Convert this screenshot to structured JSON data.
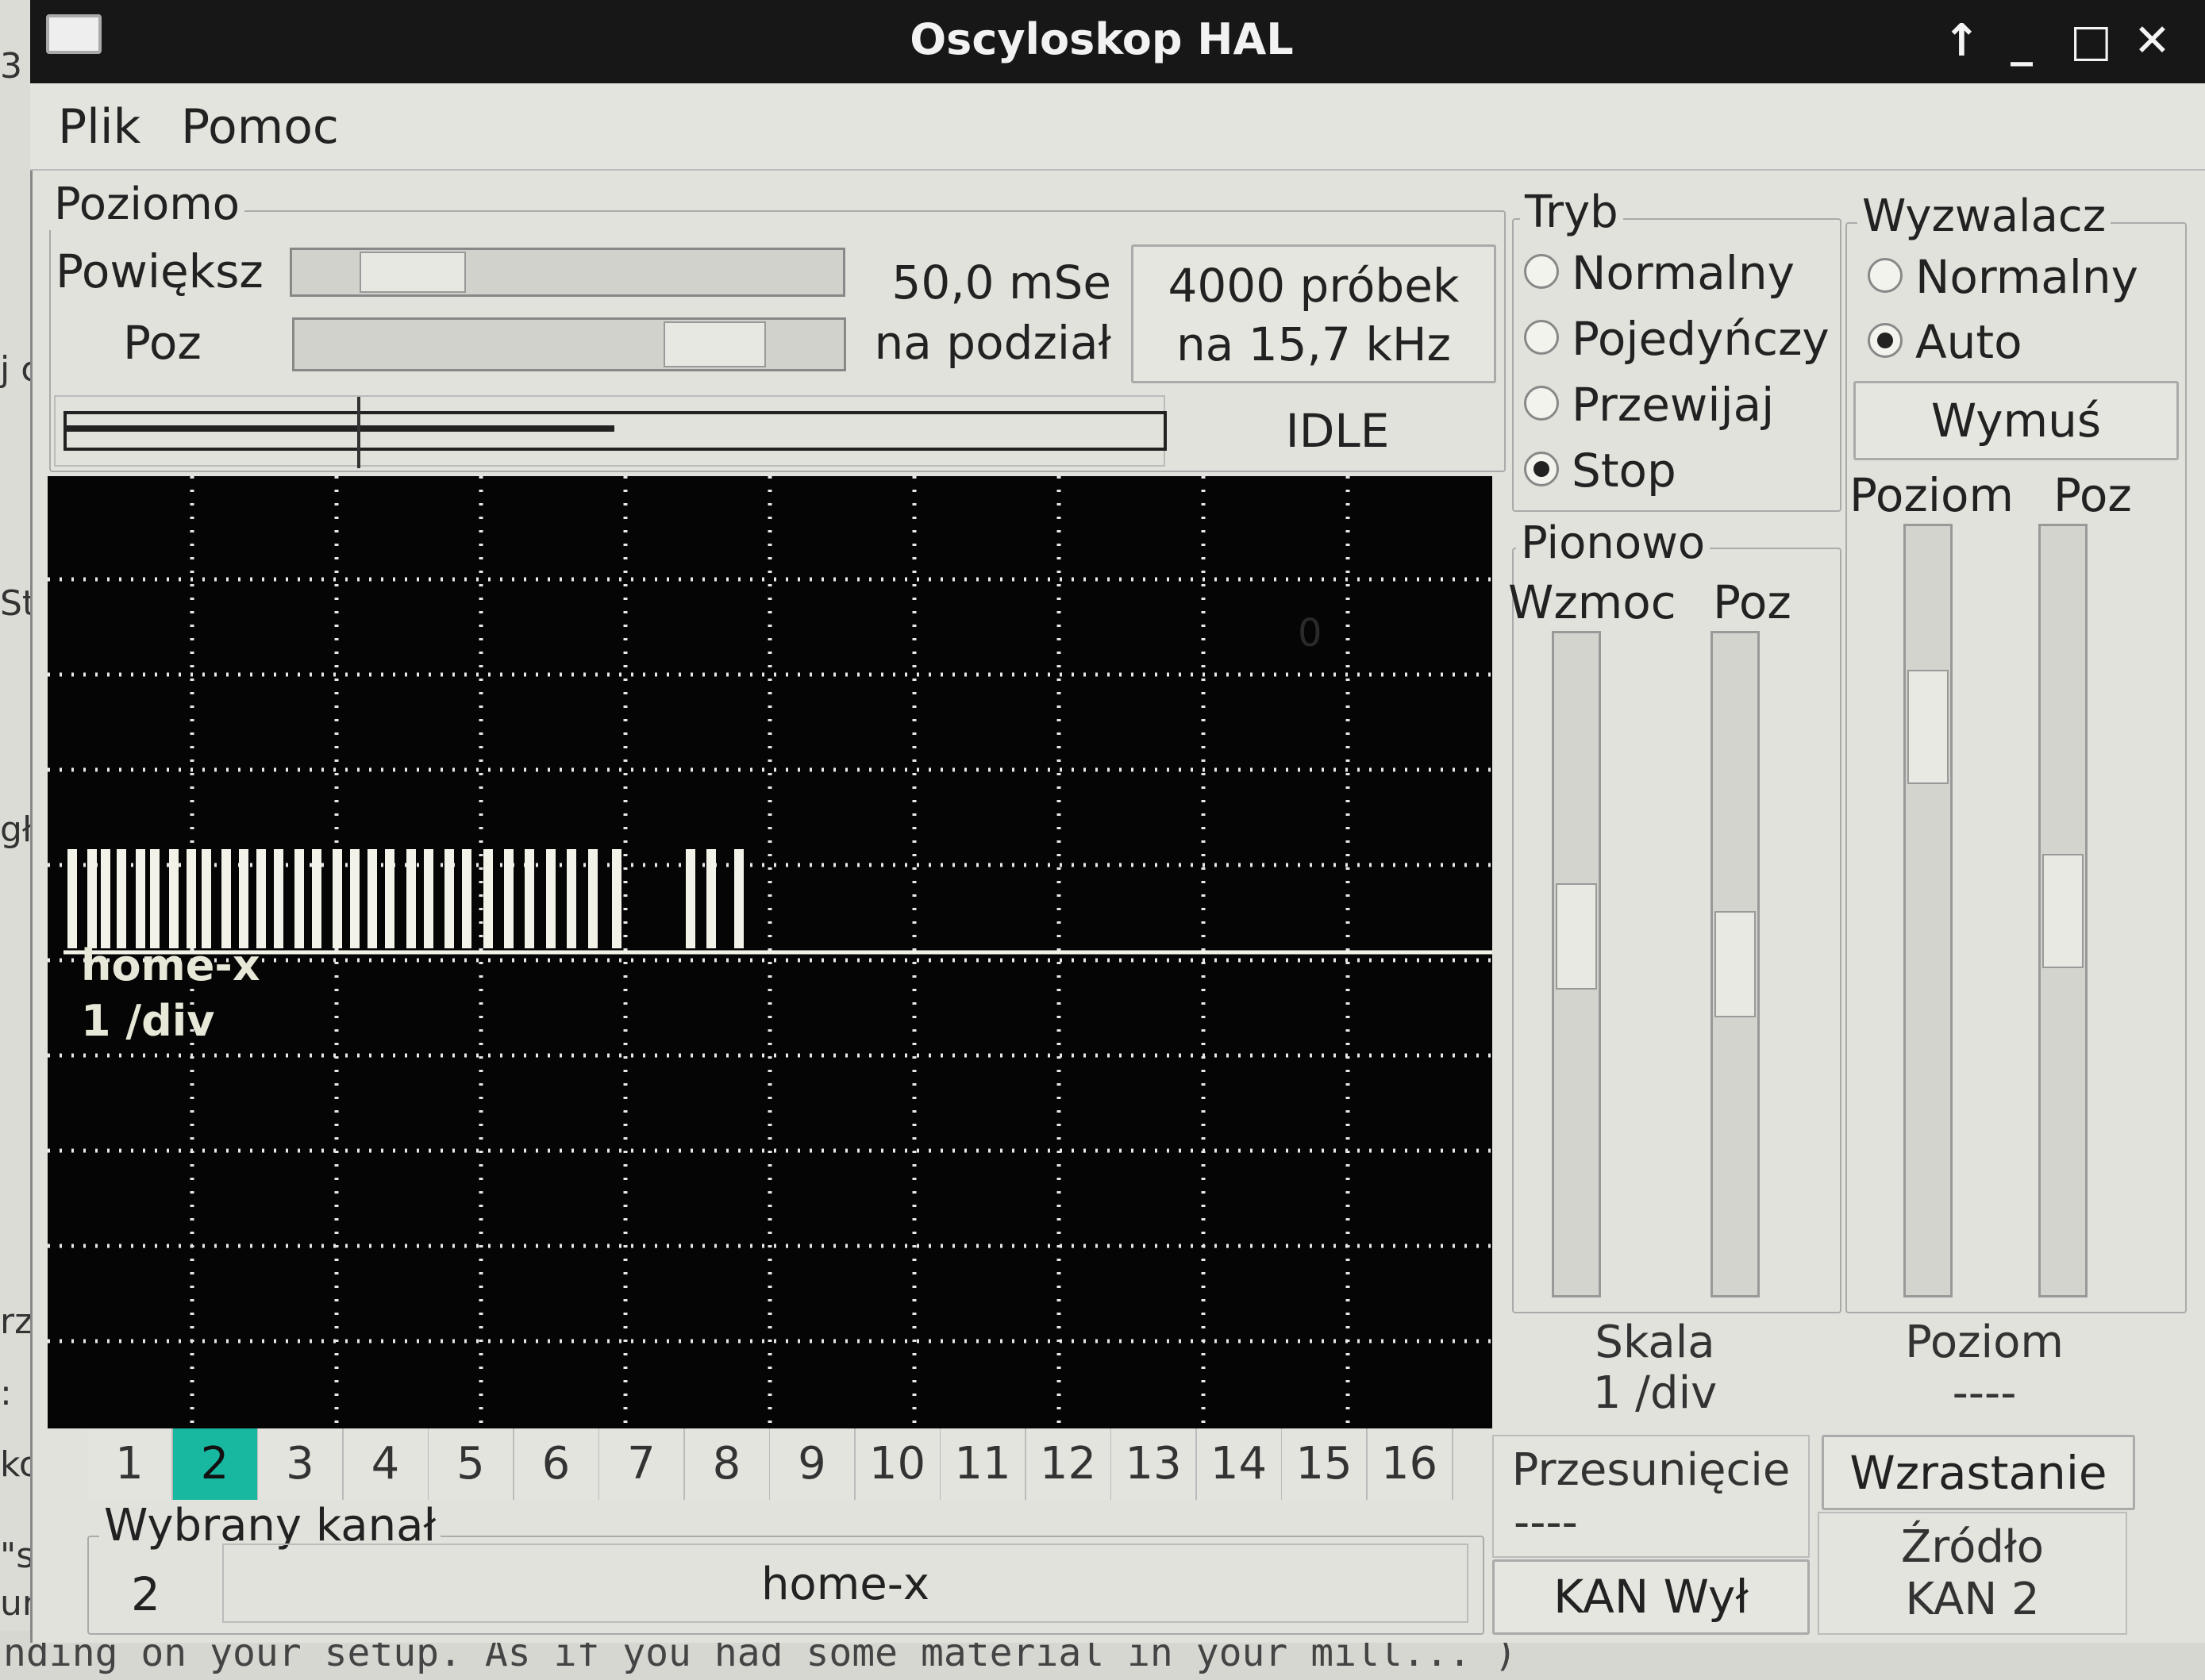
{
  "window": {
    "title": "Oscyloskop HAL"
  },
  "menu": [
    "Plik",
    "Pomoc"
  ],
  "background_fragments": {
    "left": [
      "3",
      "j c",
      "Sto",
      "gła",
      "rzec",
      ":",
      "kość",
      "\"sp",
      "un th"
    ],
    "bottom": "nding on your setup. As if you had some material in your mill... )"
  },
  "horizontal": {
    "frame_label": "Poziomo",
    "zoom_label": "Powiększ",
    "pos_label": "Poz",
    "zoom_fraction": 0.15,
    "pos_fraction": 0.82,
    "time_per_div_line1": "50,0 mSe",
    "time_per_div_line2": "na podział",
    "samples_line1": "4000 próbek",
    "samples_line2": "na 15,7 kHz",
    "state": "IDLE",
    "record_fraction": 0.5
  },
  "scope": {
    "channel_label": "home-x",
    "scale_label": "1 /div",
    "ground_marker": "0",
    "pulse_offsets": [
      0.0,
      0.028,
      0.048,
      0.07,
      0.098,
      0.118,
      0.145,
      0.17,
      0.192,
      0.22,
      0.245,
      0.27,
      0.295,
      0.325,
      0.35,
      0.38,
      0.405,
      0.43,
      0.455,
      0.485,
      0.51,
      0.54,
      0.565,
      0.595,
      0.625,
      0.655,
      0.685,
      0.715,
      0.745,
      0.78,
      0.885,
      0.915,
      0.955
    ],
    "colors": {
      "grid": "#e8e8e8",
      "trace": "#f2f2e8",
      "background": "#050505"
    }
  },
  "channels": {
    "tabs": [
      "1",
      "2",
      "3",
      "4",
      "5",
      "6",
      "7",
      "8",
      "9",
      "10",
      "11",
      "12",
      "13",
      "14",
      "15",
      "16"
    ],
    "selected": "2"
  },
  "selected_channel": {
    "frame_label": "Wybrany kanał",
    "number": "2",
    "name": "home-x"
  },
  "mode": {
    "frame_label": "Tryb",
    "options": [
      "Normalny",
      "Pojedyńczy",
      "Przewijaj",
      "Stop"
    ],
    "selected": "Stop"
  },
  "vertical": {
    "frame_label": "Pionowo",
    "gain_label": "Wzmoc",
    "pos_label": "Poz",
    "scale_title": "Skala",
    "scale_value": "1 /div",
    "offset_title": "Przesunięcie",
    "offset_value": "----",
    "channel_off_button": "KAN Wył",
    "gain_fraction": 0.45,
    "pos_fraction": 0.5
  },
  "trigger": {
    "frame_label": "Wyzwalacz",
    "options": [
      "Normalny",
      "Auto"
    ],
    "selected": "Auto",
    "force_button": "Wymuś",
    "level_label": "Poziom",
    "pos_label": "Poz",
    "level_title": "Poziom",
    "level_value": "----",
    "edge_button": "Wzrastanie",
    "source_title": "Źródło",
    "source_value": "KAN  2",
    "level_fraction": 0.78,
    "pos_fraction": 0.5
  }
}
